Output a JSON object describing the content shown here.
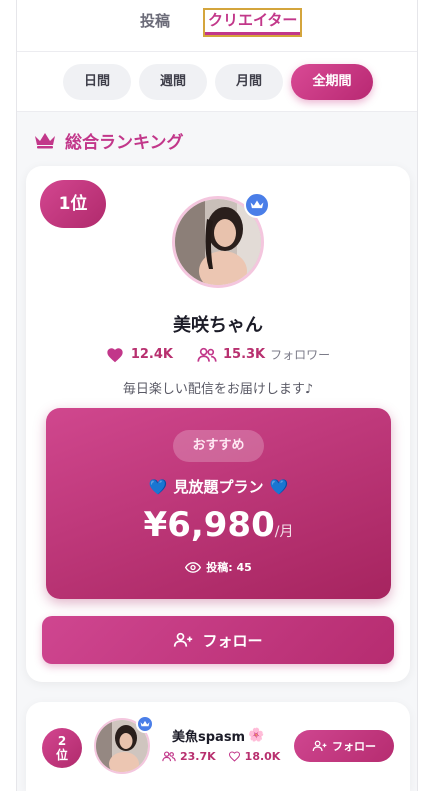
{
  "tabs": {
    "post_label": "投稿",
    "creator_label": "クリエイター"
  },
  "periods": {
    "items": [
      "日間",
      "週間",
      "月間",
      "全期間"
    ],
    "selected": "全期間"
  },
  "section": {
    "title": "総合ランキング",
    "icon": "crown-icon"
  },
  "first_place": {
    "rank_label": "1位",
    "name": "美咲ちゃん",
    "likes": "12.4K",
    "followers": "15.3K",
    "followers_label": "フォロワー",
    "bio": "毎日楽しい配信をお届けします♪",
    "plan": {
      "badge": "おすすめ",
      "heart_left": "💙",
      "name": "見放題プラン",
      "heart_right": "💙",
      "price": "¥6,980",
      "unit": "/月",
      "posts_label": "投稿: 45"
    },
    "follow_label": "フォロー",
    "colors": {
      "accent": "#c2378a",
      "verified": "#4a7ee8"
    }
  },
  "second_place": {
    "rank_line1": "2",
    "rank_line2": "位",
    "name": "美魚spasm",
    "name_emoji": "🌸",
    "followers": "23.7K",
    "likes": "18.0K",
    "follow_label": "フォロー"
  }
}
